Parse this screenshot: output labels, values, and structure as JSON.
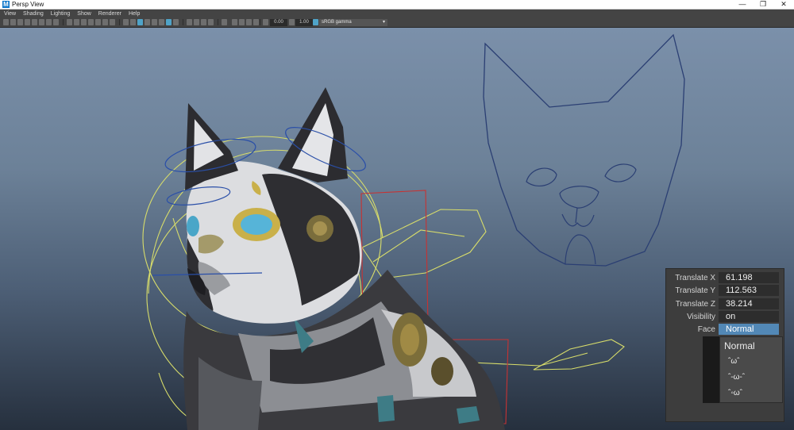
{
  "window": {
    "title": "Persp View",
    "app_logo": "M"
  },
  "menu": [
    "View",
    "Shading",
    "Lighting",
    "Show",
    "Renderer",
    "Help"
  ],
  "toolbar": {
    "exposure_value": "0.00",
    "gamma_value": "1.00",
    "color_space": "sRGB gamma"
  },
  "channel_box": {
    "rows": [
      {
        "label": "Translate X",
        "value": "61.198"
      },
      {
        "label": "Translate Y",
        "value": "112.563"
      },
      {
        "label": "Translate Z",
        "value": "38.214"
      },
      {
        "label": "Visibility",
        "value": "on"
      },
      {
        "label": "Face",
        "value": "Normal"
      }
    ]
  },
  "face_dropdown": {
    "options": [
      "Normal",
      "ˆωˆ",
      "ˆ-ω-ˆ",
      "ˆ◦ωˆ"
    ]
  },
  "colors": {
    "accent": "#5288b6",
    "panel_bg": "#3d3d3d",
    "control_curve": "#d8dd6a",
    "joint": "#2a4fa8",
    "face_outline": "#2b3f73"
  }
}
